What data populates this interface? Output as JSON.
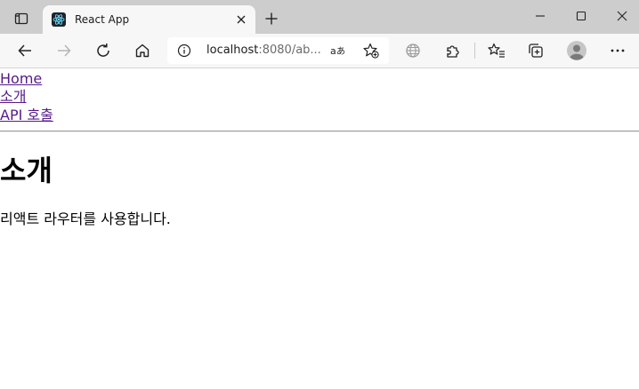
{
  "browser": {
    "tab": {
      "title": "React App",
      "favicon": "react-logo-icon"
    },
    "address": {
      "host": "localhost",
      "rest": ":8080/ab..."
    },
    "icons": {
      "tab_actions": "tab-actions-icon",
      "close_tab": "close-icon",
      "new_tab": "plus-icon",
      "minimize": "minimize-icon",
      "maximize": "maximize-icon",
      "close_window": "close-icon",
      "back": "back-arrow-icon",
      "forward": "forward-arrow-icon",
      "refresh": "refresh-icon",
      "home": "home-icon",
      "site_info": "info-icon",
      "read_aloud": "read-aloud-icon",
      "add_favorite": "add-favorite-icon",
      "browser_essentials": "globe-icon",
      "extensions": "puzzle-icon",
      "favorites": "favorites-icon",
      "collections": "collections-icon",
      "profile": "profile-avatar-icon",
      "more": "more-icon"
    },
    "colors": {
      "tabbar_bg": "#cdcdcd",
      "toolbar_bg": "#f7f7f7",
      "link_visited": "#551a8b"
    }
  },
  "page": {
    "nav": {
      "home": "Home",
      "about": "소개",
      "api": "API 호출"
    },
    "heading": "소개",
    "description": "리액트 라우터를 사용합니다."
  }
}
